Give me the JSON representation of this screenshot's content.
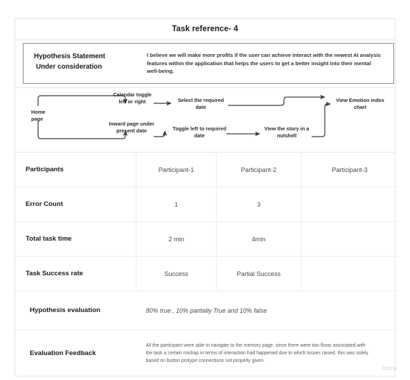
{
  "title": "Task reference- 4",
  "hypothesis": {
    "label_line1": "Hypothesis Statement",
    "label_line2": "Under consideration",
    "text": "I believe we will make more profits if the user can achieve interact with the newest AI analysis features within the application that helps the users to get a better insight into their mental well-being."
  },
  "flow": {
    "start": "Home\npage",
    "start_line1": "Home",
    "start_line2": "page",
    "node_calendar": "Calendar toggle left or right",
    "node_select_date": "Select the required date",
    "node_inward": "Inward page under present date",
    "node_toggle": "Toggle left to required date",
    "node_story": "View the story in a nutshell",
    "node_emotion": "View Emotion index chart"
  },
  "table": {
    "rows": [
      {
        "label": "Participants",
        "p1": "Participant-1",
        "p2": "Participant-2",
        "p3": "Participant-3"
      },
      {
        "label": "Error Count",
        "p1": "1",
        "p2": "3",
        "p3": ""
      },
      {
        "label": "Total task time",
        "p1": "2 min",
        "p2": "4min",
        "p3": ""
      },
      {
        "label": "Task Success rate",
        "p1": "Success",
        "p2": "Partial Success",
        "p3": ""
      }
    ],
    "evaluation": {
      "label": "Hypothesis evaluation",
      "value": "80% true , 10% partially True and 10% false"
    },
    "feedback": {
      "label": "Evaluation Feedback",
      "value": "All the participant were able to navigate to the memory page. since there were two flows associated with the task a certain mishap in terms of interaction had happened due to which issues raised. this was solely based on button protype connections not properly given."
    }
  },
  "watermark": "miro",
  "colors": {
    "border": "#e4e4e4",
    "grid": "#ededed",
    "hypothesis_box_border": "#8d8d8d",
    "arrow": "#3a3a3a",
    "text": "#1a1a1a",
    "muted_text": "#4a4a4a",
    "watermark": "#dcdcdc"
  }
}
